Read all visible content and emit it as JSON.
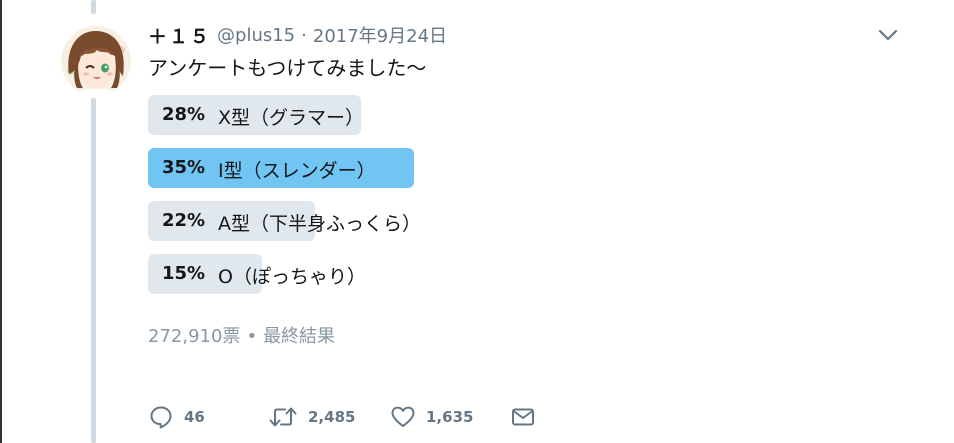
{
  "tweet": {
    "display_name": "＋１５",
    "handle": "@plus15",
    "separator": "·",
    "date": "2017年9月24日",
    "text": "アンケートもつけてみました〜"
  },
  "poll": {
    "choices": [
      {
        "percent": "28%",
        "percent_value": 28,
        "label": "X型（グラマー）",
        "winner": false
      },
      {
        "percent": "35%",
        "percent_value": 35,
        "label": "I型（スレンダー）",
        "winner": true
      },
      {
        "percent": "22%",
        "percent_value": 22,
        "label": "A型（下半身ふっくら）",
        "winner": false
      },
      {
        "percent": "15%",
        "percent_value": 15,
        "label": "O（ぽっちゃり）",
        "winner": false
      }
    ],
    "votes": "272,910票",
    "bullet": "•",
    "status": "最終結果"
  },
  "actions": {
    "reply_count": "46",
    "retweet_count": "2,485",
    "like_count": "1,635"
  },
  "icons": {
    "menu": "chevron-down-icon",
    "reply": "reply-icon",
    "retweet": "retweet-icon",
    "like": "heart-icon",
    "dm": "envelope-icon"
  },
  "colors": {
    "winner_bar": "#71c5f3",
    "other_bar": "#e1e8ed",
    "muted_text": "#657786",
    "icon": "#657786"
  }
}
